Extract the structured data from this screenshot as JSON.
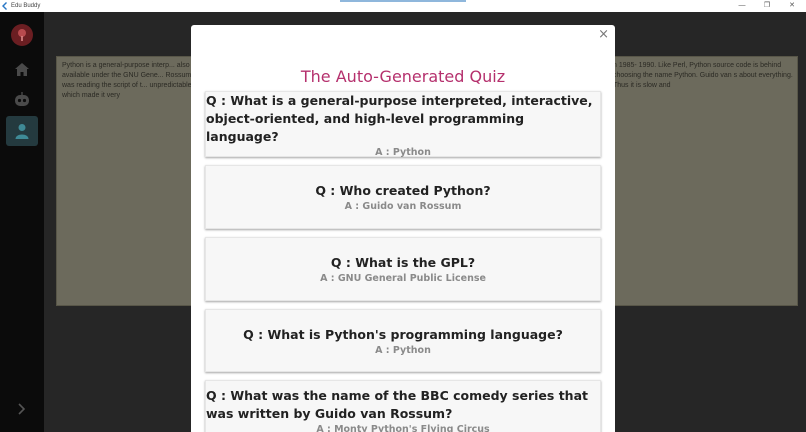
{
  "window": {
    "title": "Edu Buddy",
    "minimize": "—",
    "maximize": "❐",
    "close": "✕"
  },
  "sidebar": {
    "items": [
      {
        "name": "home",
        "icon": "home-icon"
      },
      {
        "name": "bot",
        "icon": "robot-icon"
      },
      {
        "name": "profile",
        "icon": "person-icon",
        "active": true
      }
    ],
    "expand_icon": "chevron-right-icon"
  },
  "text_panel": {
    "left_text": "Python is a general-purpose interp... also available under the GNU Gene... Rossum was reading the script of t... unpredictable, which made it very",
    "right_text": "n 1985- 1990. Like Perl, Python source code is behind choosing the name Python. Guido van s about everything. Thus it is slow and"
  },
  "quiz": {
    "title": "The Auto-Generated Quiz",
    "close_label": "×",
    "items": [
      {
        "question": "Q : What is a general-purpose interpreted, interactive, object-oriented, and high-level programming language?",
        "answer": "A : Python"
      },
      {
        "question": "Q : Who created Python?",
        "answer": "A : Guido van Rossum"
      },
      {
        "question": "Q : What is the GPL?",
        "answer": "A : GNU General Public License"
      },
      {
        "question": "Q : What is Python's programming language?",
        "answer": "A : Python"
      },
      {
        "question": "Q : What was the name of the BBC comedy series that was written by Guido van Rossum?",
        "answer": "A : Monty Python's Flying Circus"
      }
    ]
  },
  "colors": {
    "accent": "#b5306d",
    "sidebar_active": "#243a3f",
    "logo": "#6b1e22"
  }
}
